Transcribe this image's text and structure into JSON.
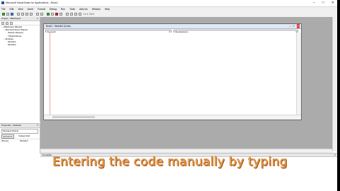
{
  "window": {
    "title": "Microsoft Visual Basic for Applications - Book1",
    "controls": [
      "–",
      "□",
      "✕"
    ]
  },
  "menu": [
    "File",
    "Edit",
    "View",
    "Insert",
    "Format",
    "Debug",
    "Run",
    "Tools",
    "Add-Ins",
    "Window",
    "Help"
  ],
  "toolbar": {
    "position": "Ln 1, Col 1"
  },
  "project_pane": {
    "title": "Project - VBAProject",
    "tree": [
      "− VBAProject (Book1)",
      "− Microsoft Excel Objects",
      "Sheet1 (Sheet1)",
      "ThisWorkbook",
      "− Modules",
      "Module1",
      "Module2"
    ]
  },
  "props_pane": {
    "title": "Properties - Module2",
    "object": "Module2 Module",
    "tabs": [
      "Alphabetic",
      "Categorized"
    ],
    "rows": [
      [
        "(Name)",
        "Module2"
      ]
    ]
  },
  "code_window": {
    "title": "Book1 - Module2 (Code)",
    "object_combo": "(General)",
    "proc_combo": "(Declarations)"
  },
  "immediate": {
    "title": "Immediate"
  },
  "caption": "Entering the code manually by typing",
  "colors": {
    "caption_fill": "#f6b45a",
    "caption_outline": "#c46a1d",
    "mdi_background": "#ababab"
  }
}
